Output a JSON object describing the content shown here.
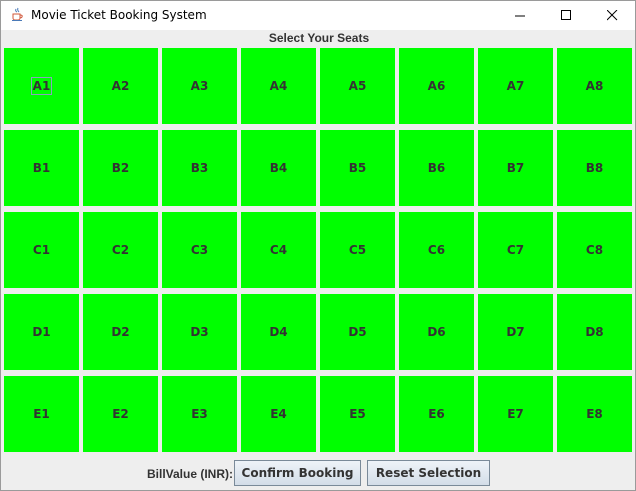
{
  "window": {
    "title": "Movie Ticket Booking System",
    "icon": "java-coffee-cup-icon",
    "controls": [
      "minimize-icon",
      "maximize-icon",
      "close-icon"
    ]
  },
  "header": {
    "label": "Select Your Seats"
  },
  "seats": {
    "color": "#00ff00",
    "focused": "A1",
    "rows": [
      [
        "A1",
        "A2",
        "A3",
        "A4",
        "A5",
        "A6",
        "A7",
        "A8"
      ],
      [
        "B1",
        "B2",
        "B3",
        "B4",
        "B5",
        "B6",
        "B7",
        "B8"
      ],
      [
        "C1",
        "C2",
        "C3",
        "C4",
        "C5",
        "C6",
        "C7",
        "C8"
      ],
      [
        "D1",
        "D2",
        "D3",
        "D4",
        "D5",
        "D6",
        "D7",
        "D8"
      ],
      [
        "E1",
        "E2",
        "E3",
        "E4",
        "E5",
        "E6",
        "E7",
        "E8"
      ]
    ]
  },
  "footer": {
    "bill_label": "BillValue (INR):",
    "confirm_label": "Confirm Booking",
    "reset_label": "Reset Selection"
  }
}
